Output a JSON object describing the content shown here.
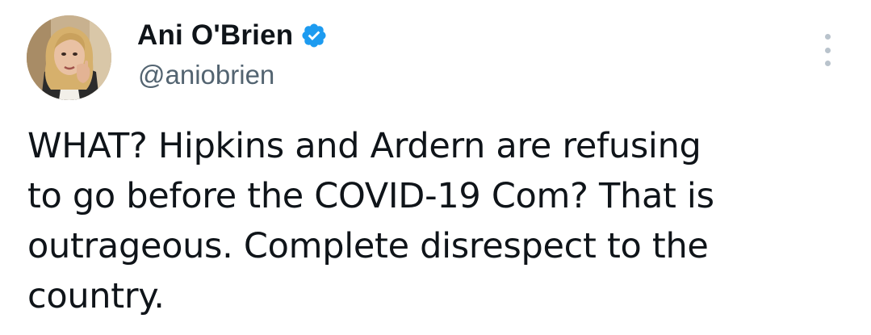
{
  "tweet": {
    "author": {
      "display_name": "Ani O'Brien",
      "handle": "@aniobrien",
      "verified": true
    },
    "text_lines": [
      "WHAT? Hipkins and Ardern are refusing",
      "to go before the COVID-19 Com? That is",
      "outrageous. Complete disrespect to the",
      "country."
    ],
    "icons": {
      "verified": "verified-badge-icon",
      "more": "more-options-icon"
    }
  },
  "colors": {
    "text_primary": "#0f1419",
    "text_secondary": "#536471",
    "verified_blue": "#1d9bf0",
    "more_dots": "#b9c3cc"
  }
}
